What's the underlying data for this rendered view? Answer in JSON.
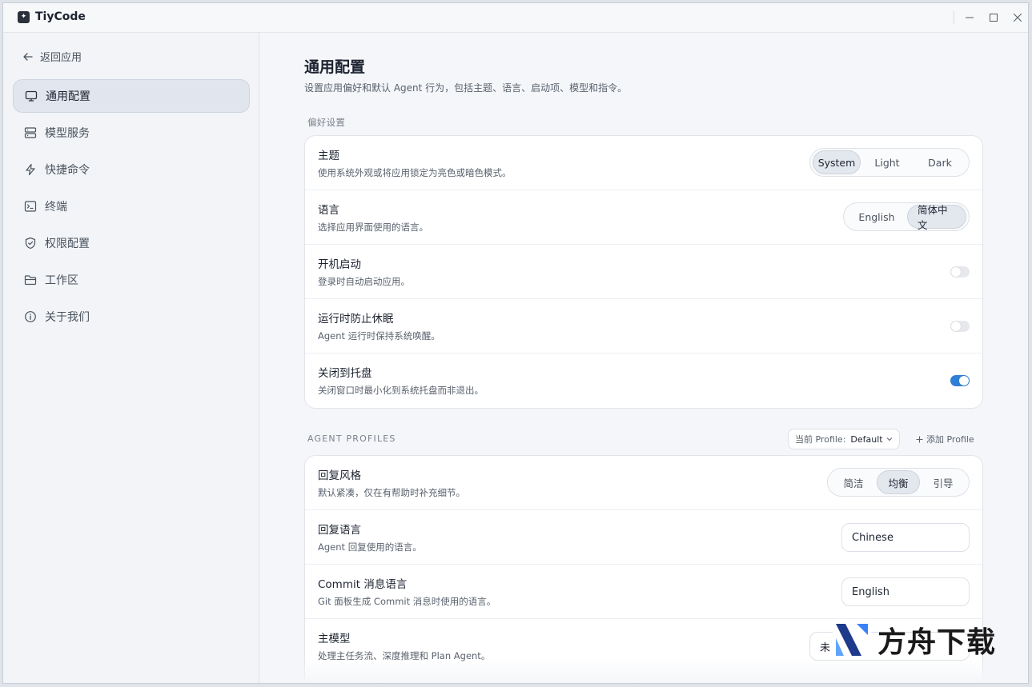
{
  "app": {
    "name": "TiyCode"
  },
  "sidebar": {
    "back_label": "返回应用",
    "items": [
      {
        "label": "通用配置",
        "icon": "monitor-icon",
        "active": true
      },
      {
        "label": "模型服务",
        "icon": "server-icon",
        "active": false
      },
      {
        "label": "快捷命令",
        "icon": "lightning-icon",
        "active": false
      },
      {
        "label": "终端",
        "icon": "terminal-icon",
        "active": false
      },
      {
        "label": "权限配置",
        "icon": "shield-icon",
        "active": false
      },
      {
        "label": "工作区",
        "icon": "folder-icon",
        "active": false
      },
      {
        "label": "关于我们",
        "icon": "info-icon",
        "active": false
      }
    ]
  },
  "main": {
    "title": "通用配置",
    "subtitle": "设置应用偏好和默认 Agent 行为，包括主题、语言、启动项、模型和指令。",
    "preferences": {
      "label": "偏好设置",
      "theme": {
        "title": "主题",
        "desc": "使用系统外观或将应用锁定为亮色或暗色模式。",
        "options": [
          "System",
          "Light",
          "Dark"
        ],
        "selected": "System"
      },
      "language": {
        "title": "语言",
        "desc": "选择应用界面使用的语言。",
        "options": [
          "English",
          "简体中文"
        ],
        "selected": "简体中文"
      },
      "autostart": {
        "title": "开机启动",
        "desc": "登录时自动启动应用。",
        "on": false
      },
      "prevent_sleep": {
        "title": "运行时防止休眠",
        "desc": "Agent 运行时保持系统唤醒。",
        "on": false
      },
      "close_to_tray": {
        "title": "关闭到托盘",
        "desc": "关闭窗口时最小化到系统托盘而非退出。",
        "on": true
      }
    },
    "agent_profiles": {
      "label": "AGENT PROFILES",
      "current_label": "当前 Profile:",
      "current_value": "Default",
      "add_label": "添加 Profile",
      "reply_style": {
        "title": "回复风格",
        "desc": "默认紧凑，仅在有帮助时补充细节。",
        "options": [
          "简洁",
          "均衡",
          "引导"
        ],
        "selected": "均衡"
      },
      "reply_language": {
        "title": "回复语言",
        "desc": "Agent 回复使用的语言。",
        "value": "Chinese"
      },
      "commit_language": {
        "title": "Commit 消息语言",
        "desc": "Git 面板生成 Commit 消息时使用的语言。",
        "value": "English"
      },
      "main_model": {
        "title": "主模型",
        "desc": "处理主任务流、深度推理和 Plan Agent。",
        "value": "未"
      }
    }
  },
  "watermark": {
    "text": "方舟下载"
  },
  "colors": {
    "accent": "#2f7fd6",
    "selected_bg": "#e3e7ee"
  }
}
